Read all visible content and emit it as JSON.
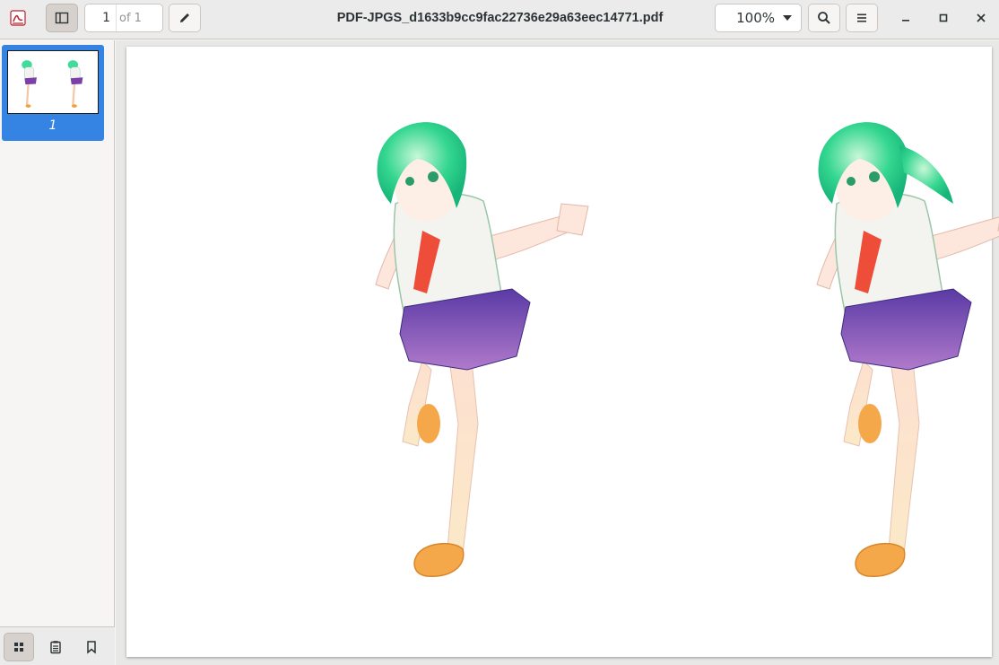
{
  "header": {
    "title": "PDF-JPGS_d1633b9cc9fac22736e29a63eec14771.pdf",
    "page_number": "1",
    "page_total": "of 1",
    "zoom": "100%"
  },
  "sidebar": {
    "thumbnails": [
      {
        "label": "1",
        "selected": true
      }
    ]
  },
  "colors": {
    "accent": "#3584e4",
    "headerbar": "#ebebeb",
    "document_bg": "#e8e8e7"
  },
  "icons": {
    "app": "document-viewer-icon",
    "sidebar_toggle": "sidebar-toggle-icon",
    "annotate": "pencil-icon",
    "search": "search-icon",
    "menu": "hamburger-menu-icon",
    "minimize": "minimize-icon",
    "maximize": "maximize-icon",
    "close": "close-icon",
    "thumbnails": "grid-icon",
    "annotations": "notes-icon",
    "bookmarks": "bookmark-icon"
  }
}
